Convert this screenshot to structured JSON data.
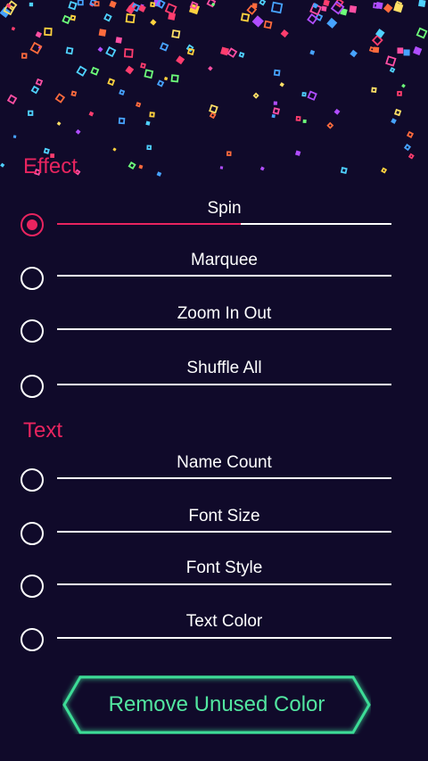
{
  "sections": {
    "effect": {
      "title": "Effect",
      "options": [
        {
          "label": "Spin",
          "selected": true,
          "level": 0.55
        },
        {
          "label": "Marquee",
          "selected": false,
          "level": 0
        },
        {
          "label": "Zoom In Out",
          "selected": false,
          "level": 0
        },
        {
          "label": "Shuffle All",
          "selected": false,
          "level": 0
        }
      ]
    },
    "text": {
      "title": "Text",
      "options": [
        {
          "label": "Name Count",
          "selected": false,
          "level": 0
        },
        {
          "label": "Font Size",
          "selected": false,
          "level": 0
        },
        {
          "label": "Font Style",
          "selected": false,
          "level": 0
        },
        {
          "label": "Text Color",
          "selected": false,
          "level": 0
        }
      ]
    }
  },
  "remove_button": {
    "label": "Remove Unused Color"
  },
  "colors": {
    "background": "#100a2a",
    "accent": "#e8245f",
    "button_glow": "#3ddc97",
    "button_text": "#52e6a0"
  }
}
